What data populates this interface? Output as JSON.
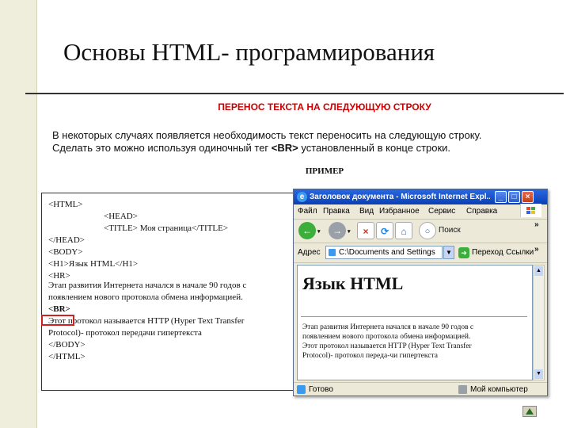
{
  "slide": {
    "title": "Основы HTML- программирования",
    "subheading": "ПЕРЕНОС ТЕКСТА НА СЛЕДУЮЩУЮ СТРОКУ",
    "desc_line1": "В некоторых случаях появляется необходимость текст переносить на следующую строку.",
    "desc_line2_pre": "Сделать это можно используя одиночный тег ",
    "desc_tag": "<BR>",
    "desc_line2_post": " установленный в конце строки.",
    "example_label": "ПРИМЕР"
  },
  "code": {
    "lines": [
      "<HTML>",
      "<HEAD>",
      "<TITLE> Моя страница</TITLE>",
      "</HEAD>",
      "<BODY>",
      "<H1>Язык HTML</H1>",
      "<HR>",
      "Этап развития Интернета начался в начале 90 годов с",
      "появлением нового протокола обмена информацией.",
      "<BR>",
      "Этот протокол называется HTTP (Hyper Text Transfer",
      "Protocol)- протокол передачи гипертекста",
      "</BODY>",
      "</HTML>"
    ]
  },
  "browser": {
    "title": "Заголовок документа - Microsoft Internet Expl...",
    "menu": [
      "Файл",
      "Правка",
      "Вид",
      "Избранное",
      "Сервис",
      "Справка"
    ],
    "toolbar": {
      "search_label": "Поиск"
    },
    "address": {
      "label": "Адрес",
      "value": "C:\\Documents and Settings",
      "go_label": "Переход",
      "links_label": "Ссылки"
    },
    "page": {
      "heading": "Язык HTML",
      "text_lines": [
        "Этап развития Интернета начался в начале 90 годов с",
        "появлением нового протокола обмена информацией.",
        "Этот протокол называется HTTP (Hyper Text Transfer",
        "Protocol)- протокол переда-чи гипертекста"
      ]
    },
    "status": {
      "left": "Готово",
      "right": "Мой компьютер"
    }
  },
  "colors": {
    "accent_red": "#cc0000",
    "titlebar_blue": "#0a3fb4",
    "sidebar": "#efeddc"
  }
}
